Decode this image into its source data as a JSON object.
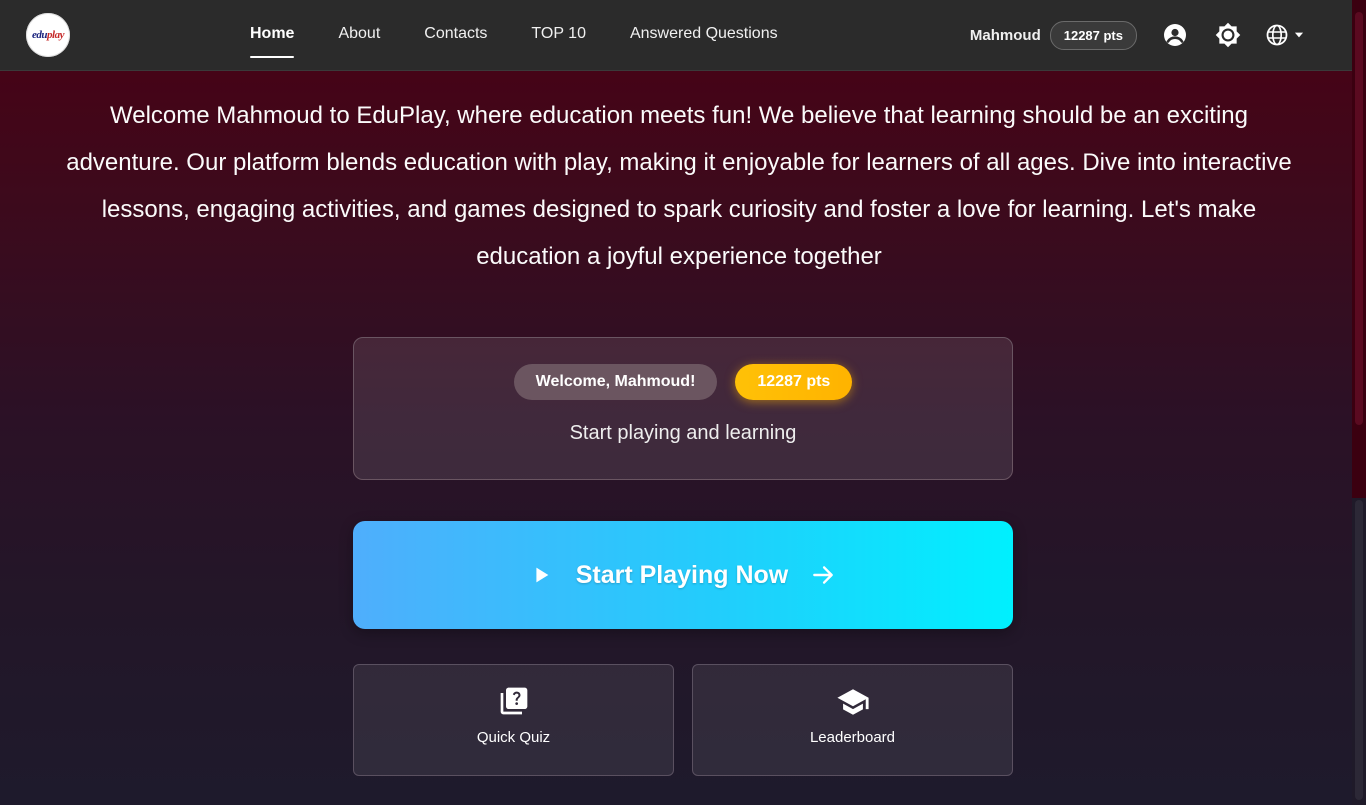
{
  "brand": {
    "logo_text_a": "edu",
    "logo_text_b": "play"
  },
  "nav": {
    "links": [
      "Home",
      "About",
      "Contacts",
      "TOP 10",
      "Answered Questions"
    ],
    "active": "Home"
  },
  "user": {
    "name": "Mahmoud",
    "points": "12287 pts"
  },
  "icons": {
    "account": "account-circle-icon",
    "theme": "brightness-icon",
    "language": "globe-icon",
    "dropdown": "caret-down-icon"
  },
  "intro": {
    "text": "Welcome Mahmoud to EduPlay, where education meets fun! We believe that learning should be an exciting adventure. Our platform blends education with play, making it enjoyable for learners of all ages. Dive into interactive lessons, engaging activities, and games designed to spark curiosity and foster a love for learning. Let's make education a joyful experience together"
  },
  "welcome_card": {
    "greeting": "Welcome, Mahmoud!",
    "points": "12287 pts",
    "subtitle": "Start playing and learning"
  },
  "cta": {
    "label": "Start Playing Now",
    "gradient_start": "#4faefc",
    "gradient_end": "#00f0fe"
  },
  "tiles": [
    {
      "label": "Quick Quiz",
      "icon": "quiz-icon"
    },
    {
      "label": "Leaderboard",
      "icon": "school-icon"
    }
  ],
  "colors": {
    "points_badge": "#ffc107",
    "navbar": "#2b2b2b",
    "background_top": "#4a0014",
    "background_bottom": "#1e1a2c"
  }
}
